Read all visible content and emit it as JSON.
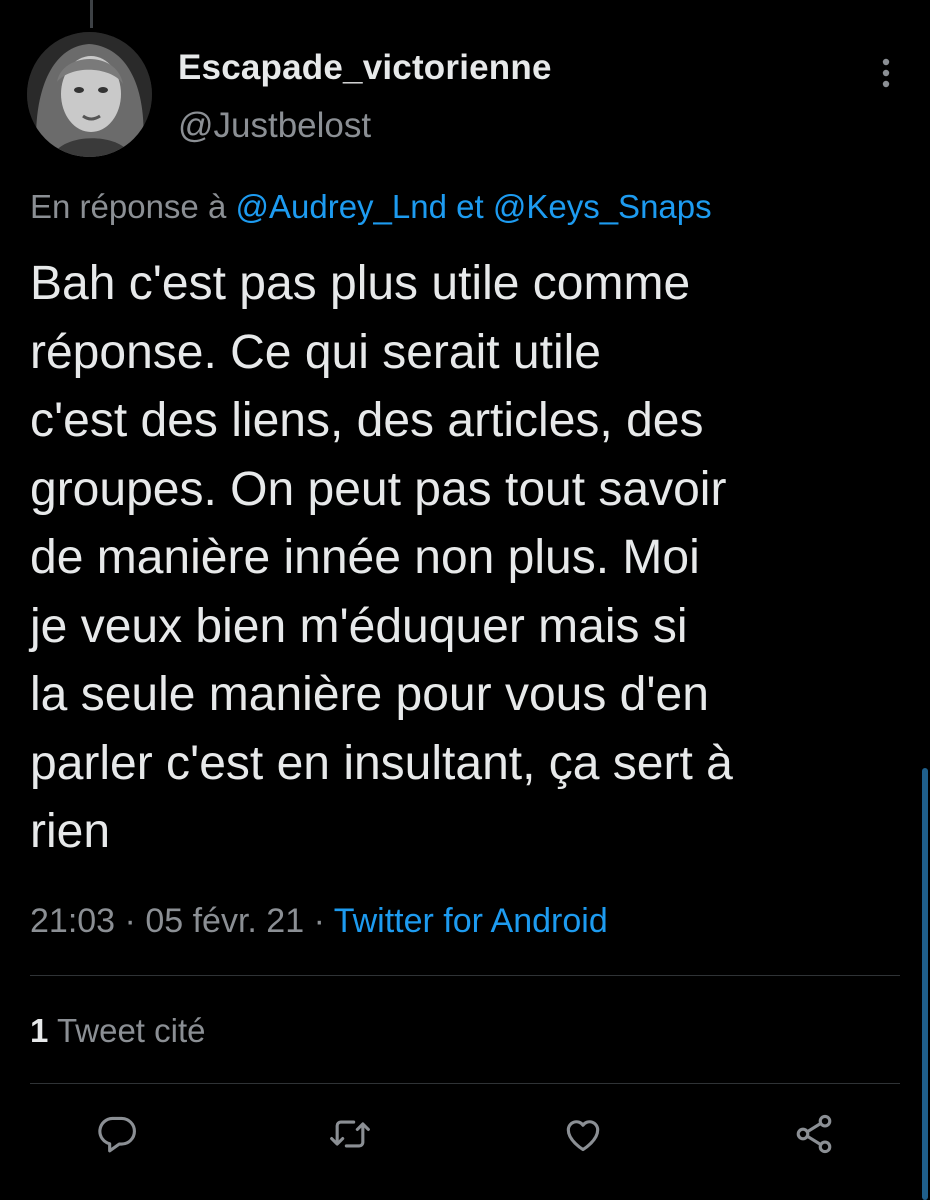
{
  "author": {
    "display_name": "Escapade_victorienne",
    "handle": "@Justbelost"
  },
  "reply": {
    "prefix": "En réponse à",
    "mention_1": "@Audrey_Lnd",
    "joiner": "et",
    "mention_2": "@Keys_Snaps"
  },
  "tweet": {
    "lines": [
      "Bah c'est pas plus utile comme",
      "réponse. Ce qui serait utile",
      "c'est des liens, des articles, des",
      "groupes. On peut pas tout savoir",
      "de manière innée non plus. Moi",
      "je veux bien m'éduquer mais si",
      "la seule manière pour vous d'en",
      "parler c'est en insultant, ça sert à",
      "rien"
    ],
    "time": "21:03",
    "date": "05 févr. 21",
    "source": "Twitter for Android"
  },
  "stats": {
    "quote_count": "1",
    "quote_label": "Tweet cité"
  },
  "icons": {
    "more": "more-vertical-icon",
    "reply": "reply-icon",
    "retweet": "retweet-icon",
    "like": "like-icon",
    "share": "share-icon"
  },
  "colors": {
    "background": "#000000",
    "accent": "#1d9bf0",
    "secondary_text": "#8b8f94",
    "primary_text": "#e7e9ea",
    "divider": "#2f3336"
  }
}
